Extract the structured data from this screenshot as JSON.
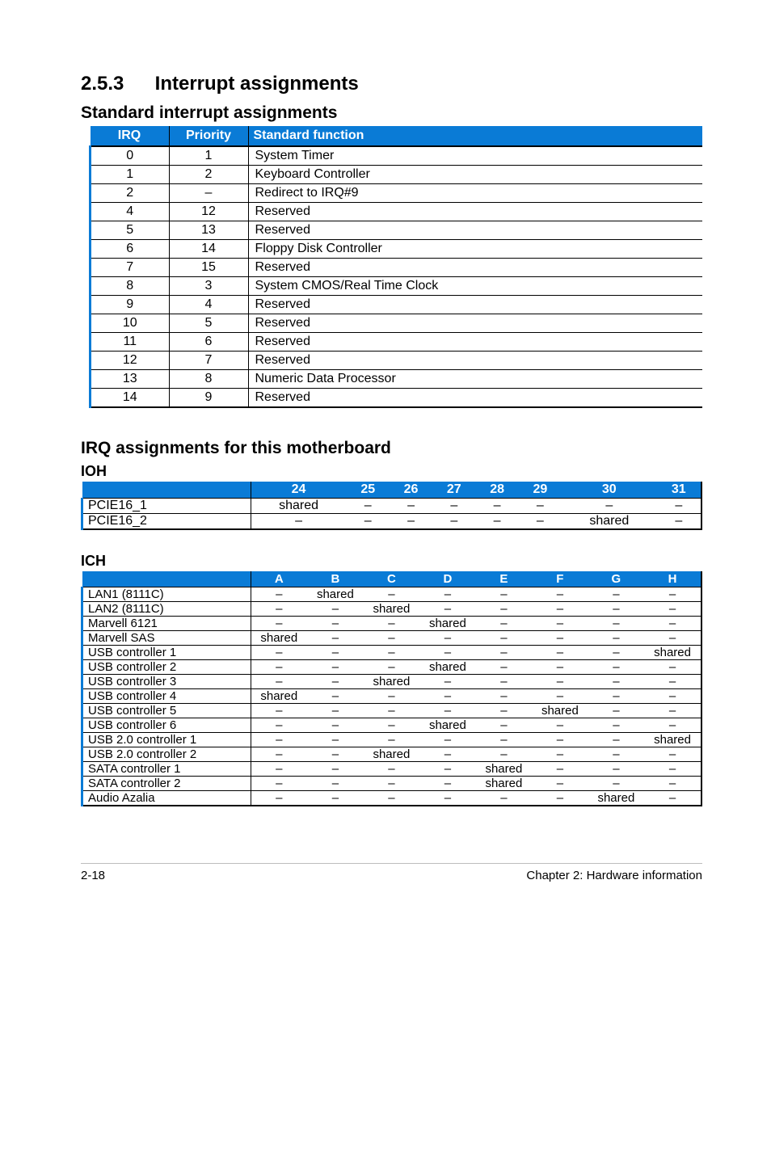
{
  "section": {
    "number": "2.5.3",
    "title": "Interrupt assignments"
  },
  "std_table": {
    "title": "Standard interrupt assignments",
    "headers": {
      "irq": "IRQ",
      "priority": "Priority",
      "func": "Standard function"
    },
    "rows": [
      {
        "irq": "0",
        "priority": "1",
        "func": "System Timer"
      },
      {
        "irq": "1",
        "priority": "2",
        "func": "Keyboard Controller"
      },
      {
        "irq": "2",
        "priority": "–",
        "func": "Redirect to IRQ#9"
      },
      {
        "irq": "4",
        "priority": "12",
        "func": "Reserved"
      },
      {
        "irq": "5",
        "priority": "13",
        "func": "Reserved"
      },
      {
        "irq": "6",
        "priority": "14",
        "func": "Floppy Disk Controller"
      },
      {
        "irq": "7",
        "priority": "15",
        "func": "Reserved"
      },
      {
        "irq": "8",
        "priority": "3",
        "func": "System CMOS/Real Time Clock"
      },
      {
        "irq": "9",
        "priority": "4",
        "func": "Reserved"
      },
      {
        "irq": "10",
        "priority": "5",
        "func": "Reserved"
      },
      {
        "irq": "11",
        "priority": "6",
        "func": "Reserved"
      },
      {
        "irq": "12",
        "priority": "7",
        "func": "Reserved"
      },
      {
        "irq": "13",
        "priority": "8",
        "func": "Numeric Data Processor"
      },
      {
        "irq": "14",
        "priority": "9",
        "func": "Reserved"
      }
    ]
  },
  "mb_section": {
    "title": "IRQ assignments for this motherboard"
  },
  "ioh": {
    "title": "IOH",
    "headers": [
      "24",
      "25",
      "26",
      "27",
      "28",
      "29",
      "30",
      "31"
    ],
    "rows": [
      {
        "device": "PCIE16_1",
        "vals": [
          "shared",
          "–",
          "–",
          "–",
          "–",
          "–",
          "–",
          "–"
        ]
      },
      {
        "device": "PCIE16_2",
        "vals": [
          "–",
          "–",
          "–",
          "–",
          "–",
          "–",
          "shared",
          "–"
        ]
      }
    ]
  },
  "ich": {
    "title": "ICH",
    "headers": [
      "A",
      "B",
      "C",
      "D",
      "E",
      "F",
      "G",
      "H"
    ],
    "rows": [
      {
        "device": "LAN1 (8111C)",
        "vals": [
          "–",
          "shared",
          "–",
          "–",
          "–",
          "–",
          "–",
          "–"
        ]
      },
      {
        "device": "LAN2 (8111C)",
        "vals": [
          "–",
          "–",
          "shared",
          "–",
          "–",
          "–",
          "–",
          "–"
        ]
      },
      {
        "device": "Marvell 6121",
        "vals": [
          "–",
          "–",
          "–",
          "shared",
          "–",
          "–",
          "–",
          "–"
        ]
      },
      {
        "device": "Marvell SAS",
        "vals": [
          "shared",
          "–",
          "–",
          "–",
          "–",
          "–",
          "–",
          "–"
        ]
      },
      {
        "device": "USB controller 1",
        "vals": [
          "–",
          "–",
          "–",
          "–",
          "–",
          "–",
          "–",
          "shared"
        ]
      },
      {
        "device": "USB controller 2",
        "vals": [
          "–",
          "–",
          "–",
          "shared",
          "–",
          "–",
          "–",
          "–"
        ]
      },
      {
        "device": "USB controller 3",
        "vals": [
          "–",
          "–",
          "shared",
          "–",
          "–",
          "–",
          "–",
          "–"
        ]
      },
      {
        "device": "USB controller 4",
        "vals": [
          "shared",
          "–",
          "–",
          "–",
          "–",
          "–",
          "–",
          "–"
        ]
      },
      {
        "device": "USB controller 5",
        "vals": [
          "–",
          "–",
          "–",
          "–",
          "–",
          "shared",
          "–",
          "–"
        ]
      },
      {
        "device": "USB controller 6",
        "vals": [
          "–",
          "–",
          "–",
          "shared",
          "–",
          "–",
          "–",
          "–"
        ]
      },
      {
        "device": "USB 2.0 controller 1",
        "vals": [
          "–",
          "–",
          "–",
          "–",
          "–",
          "–",
          "–",
          "shared"
        ]
      },
      {
        "device": "USB 2.0 controller 2",
        "vals": [
          "–",
          "–",
          "shared",
          "–",
          "–",
          "–",
          "–",
          "–"
        ]
      },
      {
        "device": "SATA controller 1",
        "vals": [
          "–",
          "–",
          "–",
          "–",
          "shared",
          "–",
          "–",
          "–"
        ]
      },
      {
        "device": "SATA controller 2",
        "vals": [
          "–",
          "–",
          "–",
          "–",
          "shared",
          "–",
          "–",
          "–"
        ]
      },
      {
        "device": "Audio Azalia",
        "vals": [
          "–",
          "–",
          "–",
          "–",
          "–",
          "–",
          "shared",
          "–"
        ]
      }
    ]
  },
  "footer": {
    "left": "2-18",
    "right": "Chapter 2: Hardware information"
  }
}
